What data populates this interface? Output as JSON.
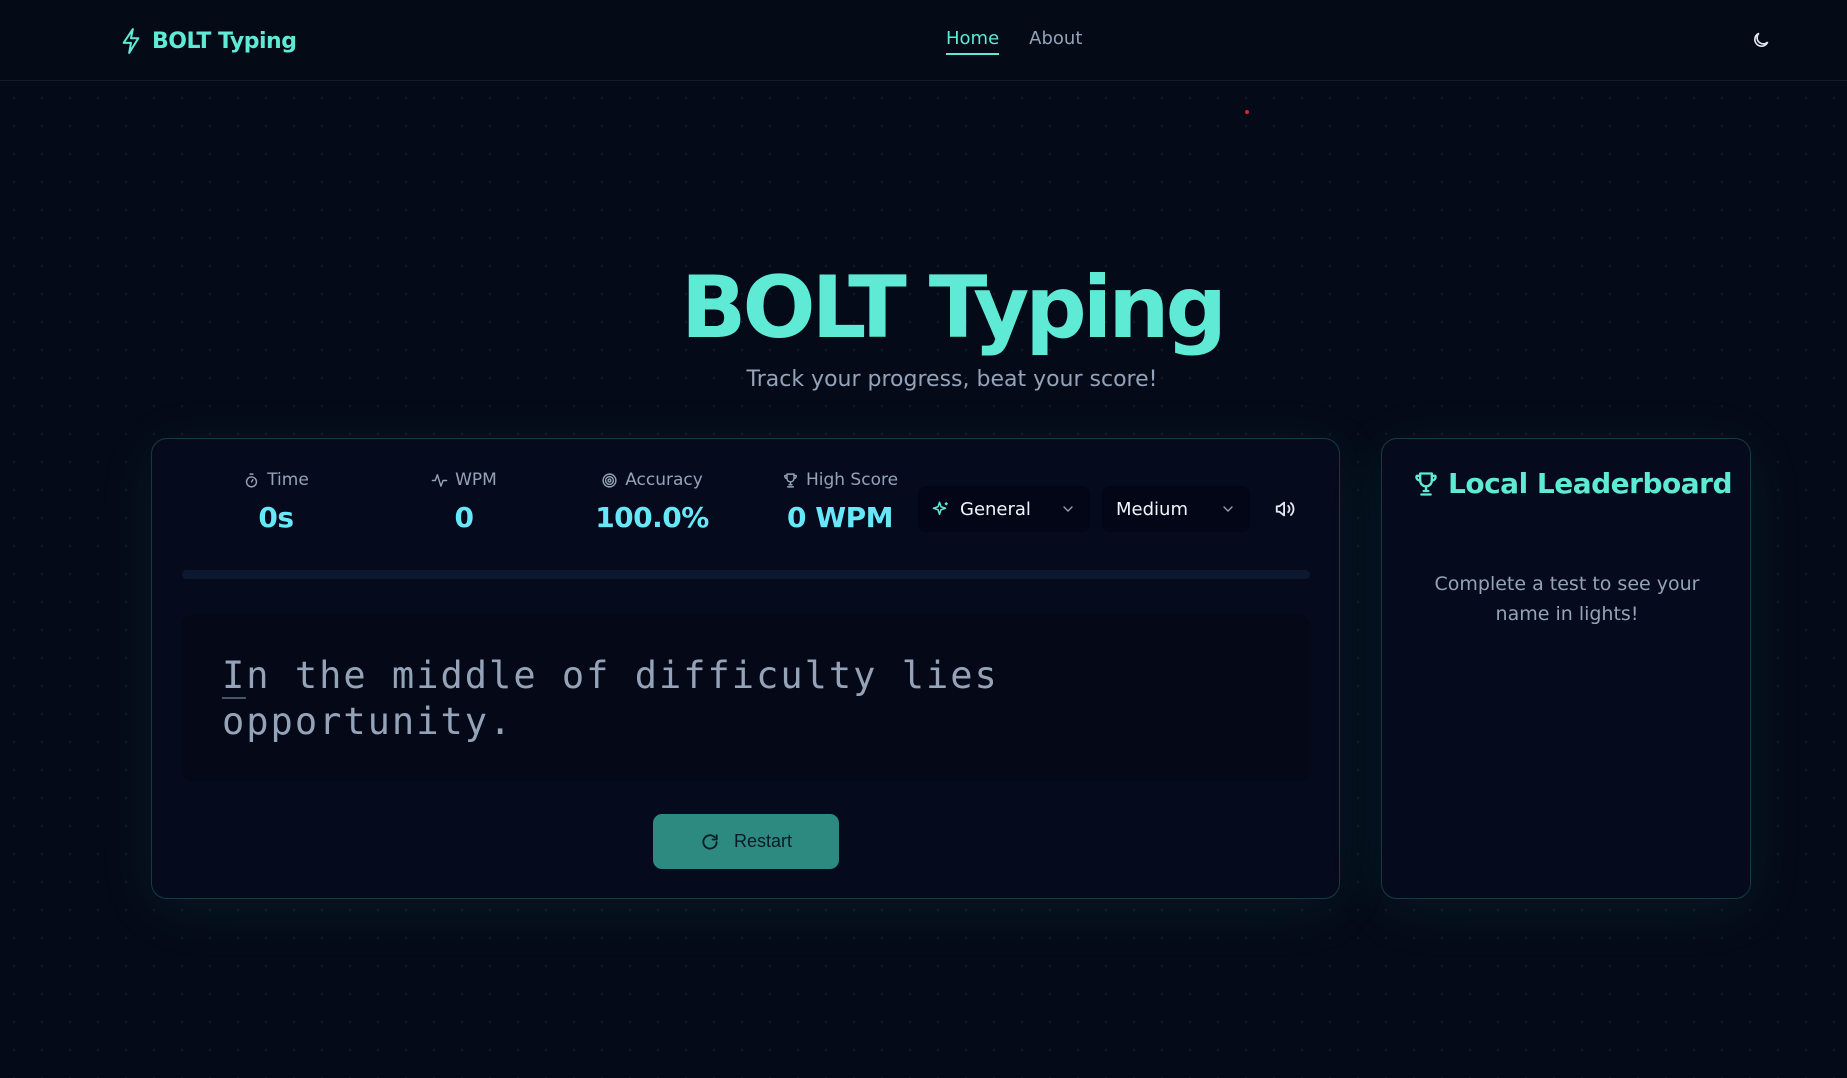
{
  "header": {
    "logo_text": "BOLT Typing",
    "nav": [
      {
        "label": "Home",
        "active": true
      },
      {
        "label": "About",
        "active": false
      }
    ],
    "theme_icon": "moon-icon"
  },
  "hero": {
    "title": "BOLT Typing",
    "subtitle": "Track your progress, beat your score!"
  },
  "stats": {
    "time": {
      "label": "Time",
      "value": "0s",
      "icon": "stopwatch-icon"
    },
    "wpm": {
      "label": "WPM",
      "value": "0",
      "icon": "activity-icon"
    },
    "accuracy": {
      "label": "Accuracy",
      "value": "100.0%",
      "icon": "target-icon"
    },
    "high_score": {
      "label": "High Score",
      "value": "0 WPM",
      "icon": "trophy-icon"
    }
  },
  "controls": {
    "category": {
      "selected": "General",
      "icon": "sparkles-icon"
    },
    "difficulty": {
      "selected": "Medium"
    },
    "sound_icon": "volume-icon"
  },
  "progress": 0,
  "typing": {
    "line1": "In the middle of difficulty lies",
    "line2": "opportunity."
  },
  "restart_label": "Restart",
  "leaderboard": {
    "title": "Local Leaderboard",
    "empty_message": "Complete a test to see your name in lights!"
  },
  "colors": {
    "accent": "#5eead4",
    "stat_value": "#67e8f9",
    "background": "#050a18",
    "restart_button": "#2c8a80"
  }
}
